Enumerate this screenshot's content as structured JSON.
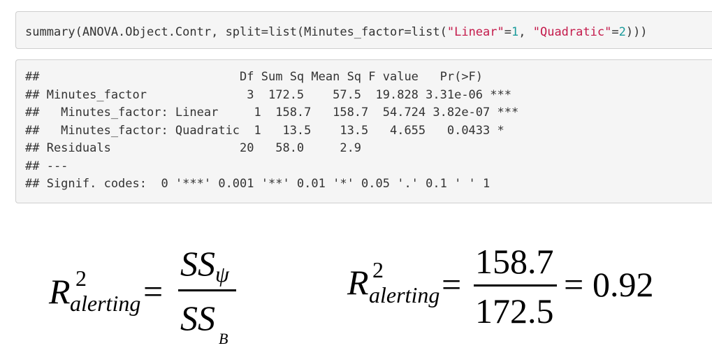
{
  "input": {
    "prefix": "summary(ANOVA.Object.Contr, split=list(Minutes_factor=list(",
    "str1": "\"Linear\"",
    "eq1": "=",
    "num1": "1",
    "sep": ", ",
    "str2": "\"Quadratic\"",
    "eq2": "=",
    "num2": "2",
    "suffix": ")))"
  },
  "output": {
    "lines": [
      "##                            Df Sum Sq Mean Sq F value   Pr(>F)    ",
      "## Minutes_factor              3  172.5    57.5  19.828 3.31e-06 ***",
      "##   Minutes_factor: Linear     1  158.7   158.7  54.724 3.82e-07 ***",
      "##   Minutes_factor: Quadratic  1   13.5    13.5   4.655   0.0433 *  ",
      "## Residuals                  20   58.0     2.9                     ",
      "## ---",
      "## Signif. codes:  0 '***' 0.001 '**' 0.01 '*' 0.05 '.' 0.1 ' ' 1"
    ]
  },
  "formula_left": {
    "R": "R",
    "sup": "2",
    "sub": "alerting",
    "eq": "=",
    "num_SS": "SS",
    "num_sub": "ψ",
    "den_SS": "SS",
    "den_sub": "B"
  },
  "formula_right": {
    "R": "R",
    "sup": "2",
    "sub": "alerting",
    "eq": "=",
    "numerator": "158.7",
    "denominator": "172.5",
    "eq2": "=",
    "result": "0.92"
  }
}
